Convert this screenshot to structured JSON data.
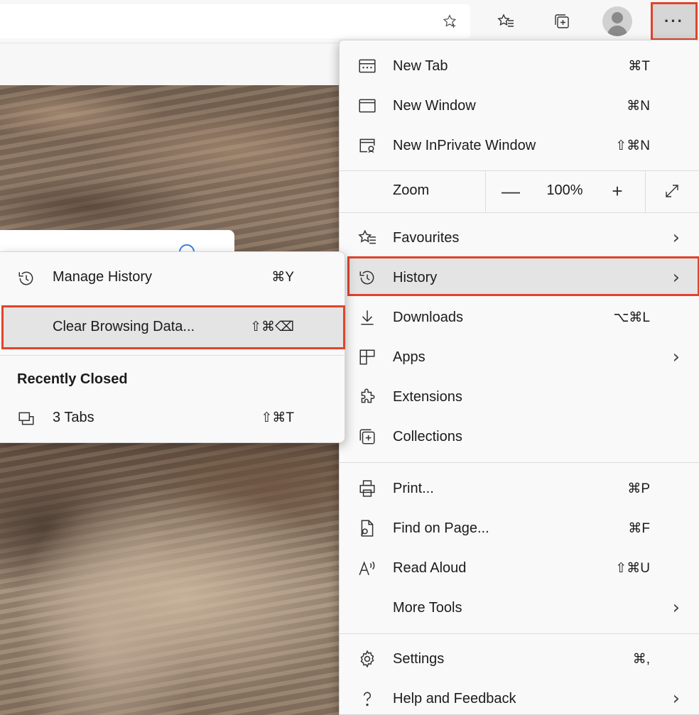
{
  "toolbar": {
    "icons": [
      "favourite-star-add-icon",
      "favourites-icon",
      "collections-icon",
      "profile-avatar-icon",
      "more-options-icon"
    ],
    "more_label": "···"
  },
  "main_menu": {
    "items": [
      {
        "label": "New Tab",
        "shortcut": "⌘T",
        "icon": "new-tab-icon"
      },
      {
        "label": "New Window",
        "shortcut": "⌘N",
        "icon": "new-window-icon"
      },
      {
        "label": "New InPrivate Window",
        "shortcut": "⇧⌘N",
        "icon": "inprivate-window-icon"
      },
      {
        "label": "Favourites",
        "shortcut": "",
        "icon": "favourites-icon",
        "submenu": true
      },
      {
        "label": "History",
        "shortcut": "",
        "icon": "history-icon",
        "submenu": true,
        "highlighted": true
      },
      {
        "label": "Downloads",
        "shortcut": "⌥⌘L",
        "icon": "download-icon"
      },
      {
        "label": "Apps",
        "shortcut": "",
        "icon": "apps-icon",
        "submenu": true
      },
      {
        "label": "Extensions",
        "shortcut": "",
        "icon": "extensions-icon"
      },
      {
        "label": "Collections",
        "shortcut": "",
        "icon": "collections-icon"
      },
      {
        "label": "Print...",
        "shortcut": "⌘P",
        "icon": "print-icon"
      },
      {
        "label": "Find on Page...",
        "shortcut": "⌘F",
        "icon": "find-icon"
      },
      {
        "label": "Read Aloud",
        "shortcut": "⇧⌘U",
        "icon": "read-aloud-icon"
      },
      {
        "label": "More Tools",
        "shortcut": "",
        "icon": "",
        "submenu": true
      },
      {
        "label": "Settings",
        "shortcut": "⌘,",
        "icon": "gear-icon"
      },
      {
        "label": "Help and Feedback",
        "shortcut": "",
        "icon": "help-icon",
        "submenu": true
      }
    ],
    "zoom": {
      "label": "Zoom",
      "minus": "—",
      "value": "100%",
      "plus": "+",
      "fullscreen_icon": "fullscreen-icon"
    },
    "chevron": "›"
  },
  "history_submenu": {
    "manage": {
      "label": "Manage History",
      "shortcut": "⌘Y",
      "icon": "history-icon"
    },
    "clear": {
      "label": "Clear Browsing Data...",
      "shortcut": "⇧⌘⌫",
      "highlighted": true
    },
    "recently_closed_heading": "Recently Closed",
    "closed_tabs": {
      "label": "3 Tabs",
      "shortcut": "⇧⌘T",
      "icon": "tabs-group-icon"
    }
  },
  "colors": {
    "highlight_border": "#e0442c",
    "menu_bg": "#f9f9f9",
    "hover_bg": "#e4e4e4"
  }
}
